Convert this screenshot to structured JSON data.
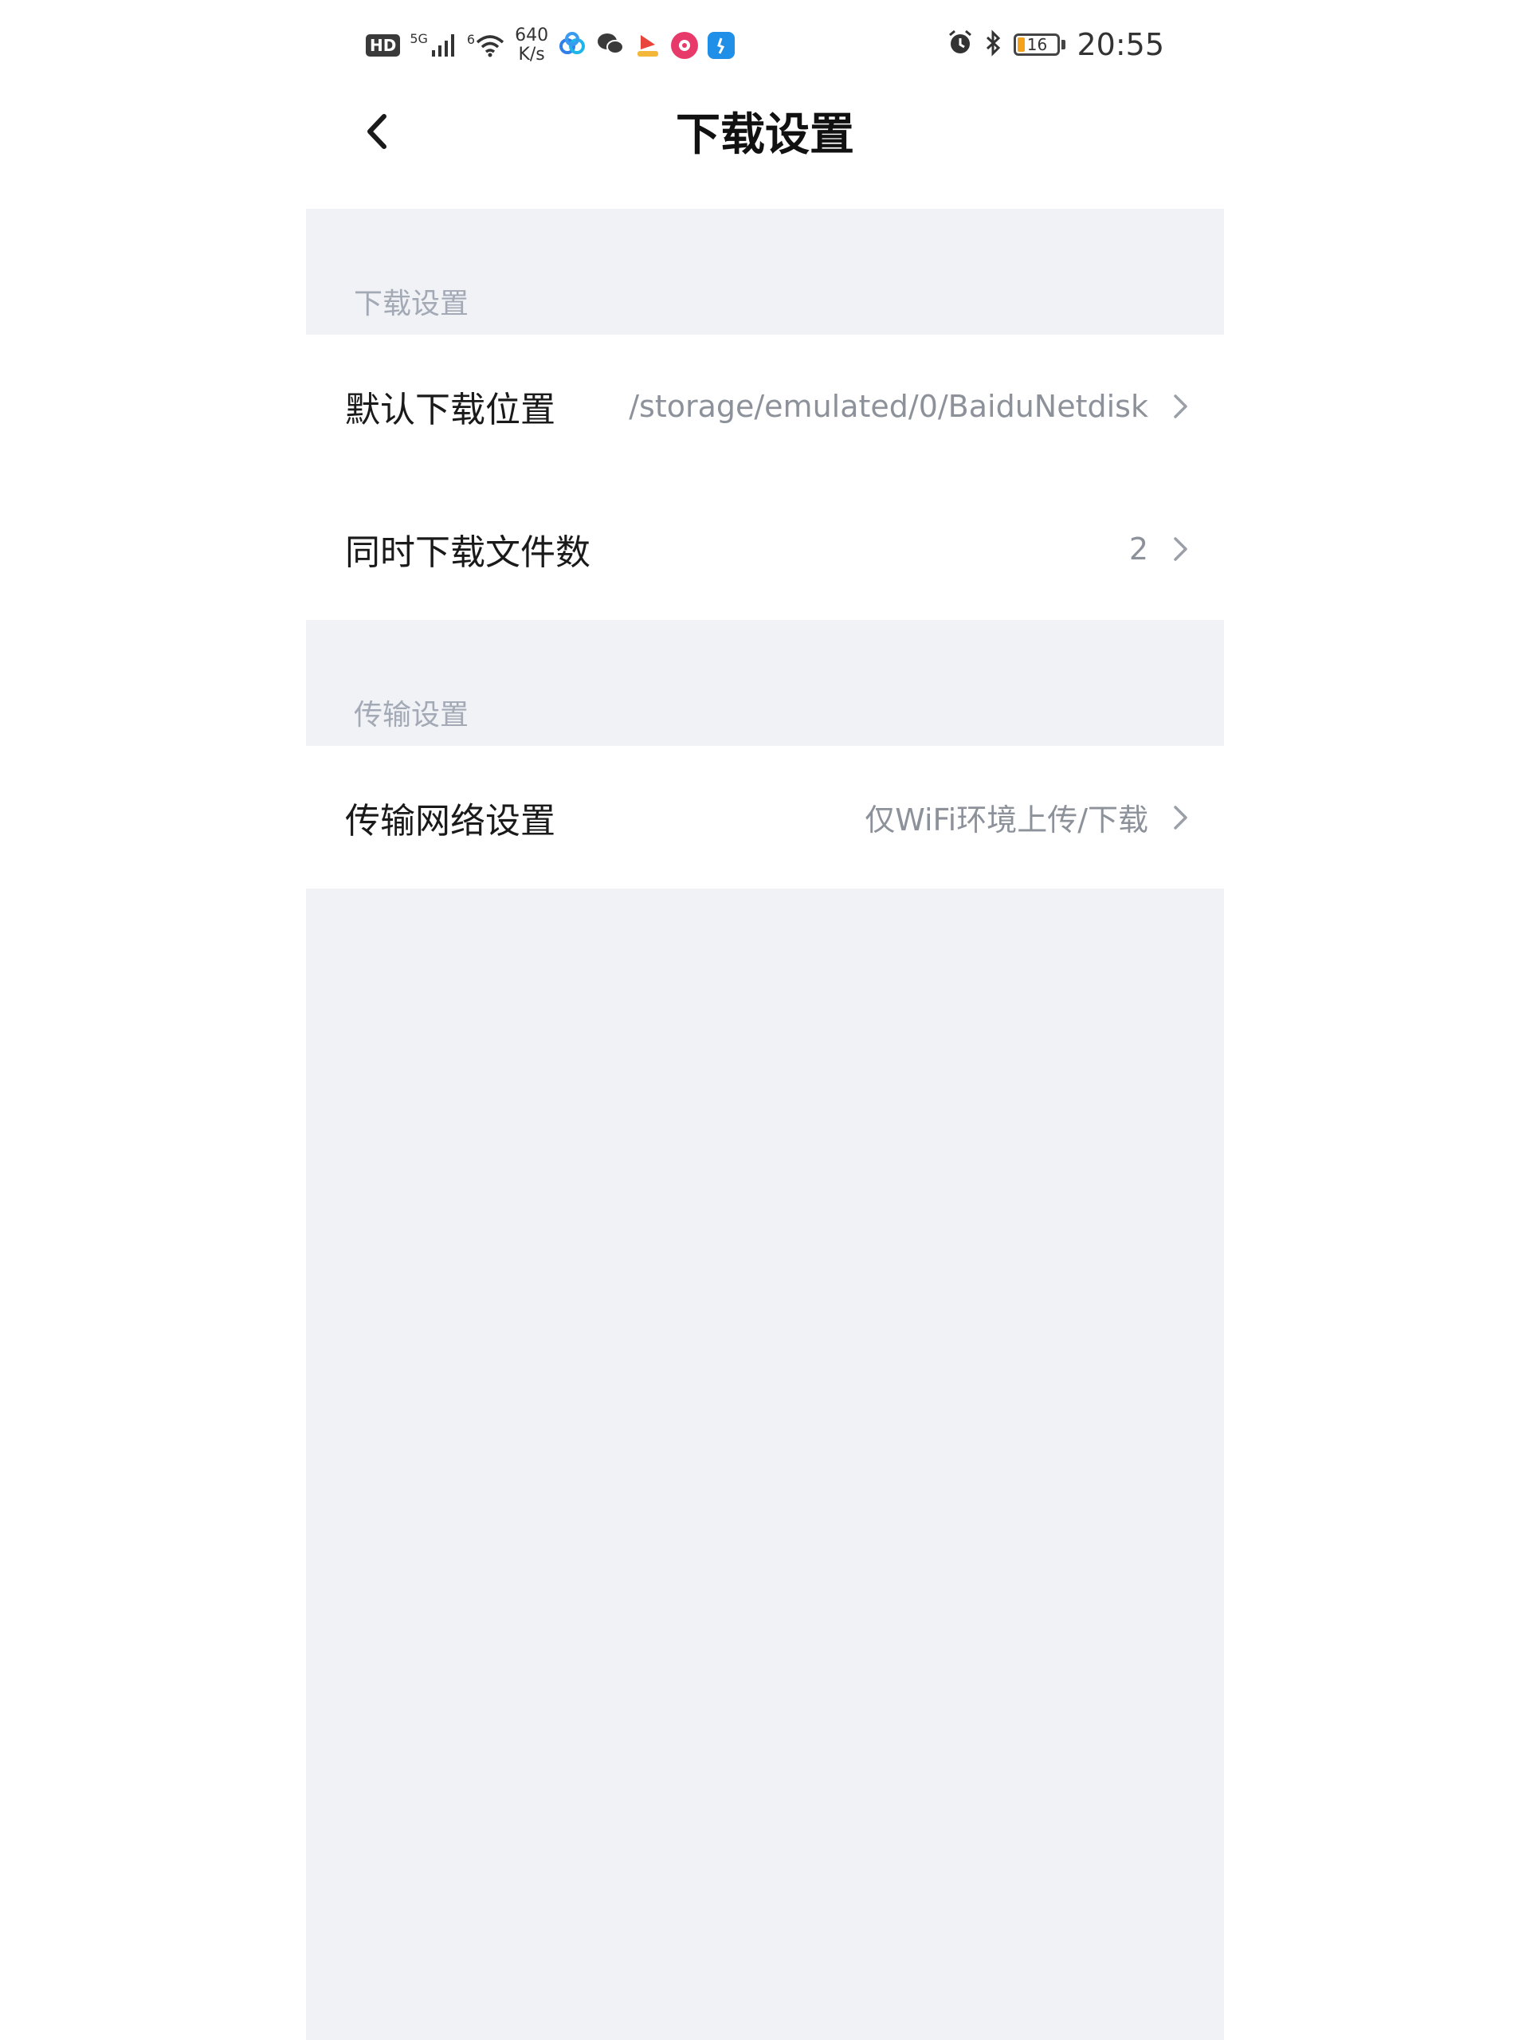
{
  "status_bar": {
    "hd_label": "HD",
    "network_5g": "5G",
    "network_6": "6",
    "speed_value": "640",
    "speed_unit": "K/s",
    "battery_level": "16",
    "time": "20:55",
    "icons": [
      "signal-icon",
      "wifi-icon",
      "baidu-netdisk-icon",
      "wechat-icon",
      "app-icon",
      "app-icon",
      "app-icon",
      "alarm-icon",
      "bluetooth-icon",
      "battery-icon"
    ],
    "colors": {
      "battery_fill": "#f3a21b"
    }
  },
  "header": {
    "title": "下载设置"
  },
  "sections": [
    {
      "title": "下载设置",
      "items": [
        {
          "label": "默认下载位置",
          "value": "/storage/emulated/0/BaiduNetdisk"
        },
        {
          "label": "同时下载文件数",
          "value": "2"
        }
      ]
    },
    {
      "title": "传输设置",
      "items": [
        {
          "label": "传输网络设置",
          "value": "仅WiFi环境上传/下载"
        }
      ]
    }
  ],
  "colors": {
    "background": "#f0f2f6",
    "row_background": "#ffffff",
    "section_label": "#a3a9b5",
    "value_text": "#8c919a"
  }
}
